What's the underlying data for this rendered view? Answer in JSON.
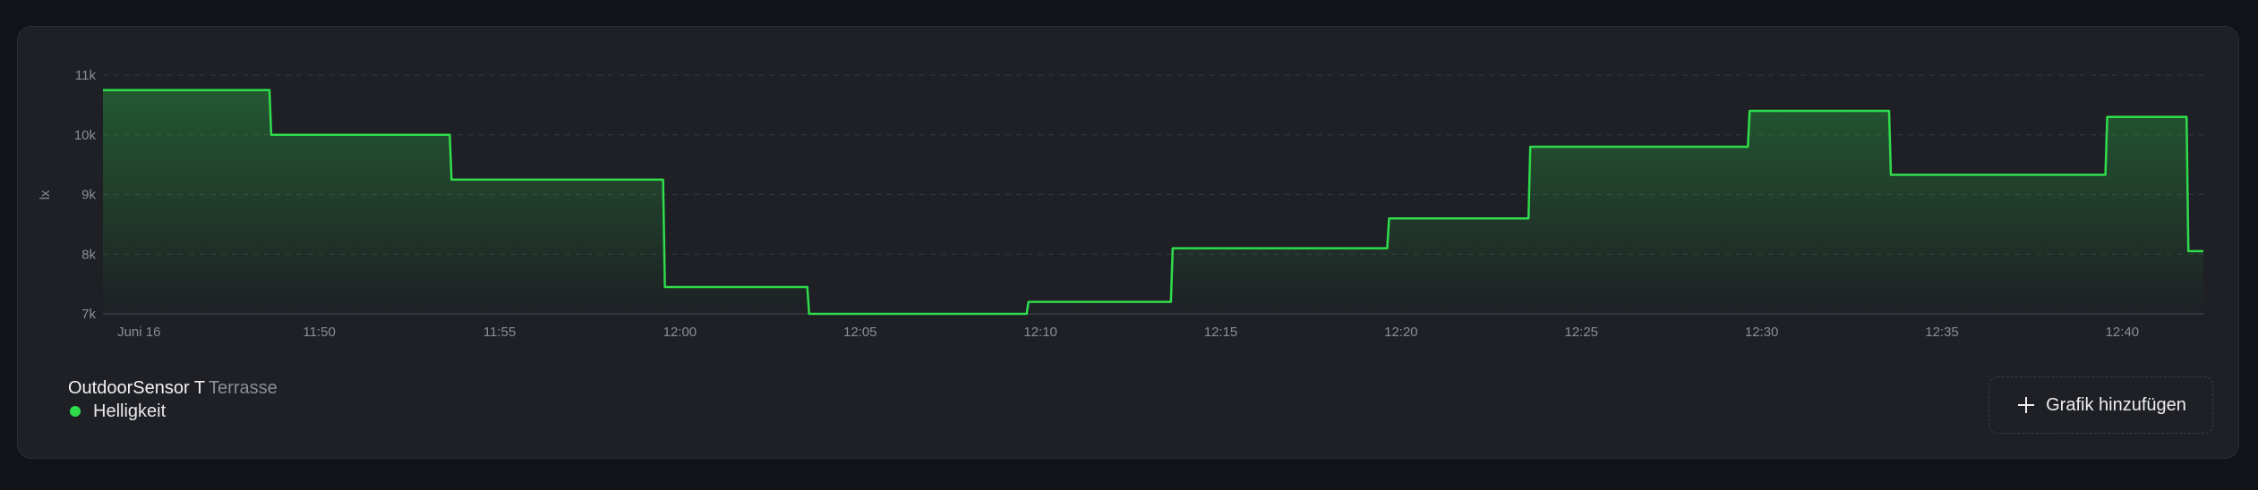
{
  "card": {
    "legend": {
      "device": "OutdoorSensor T",
      "room": "Terrasse",
      "series_name": "Helligkeit"
    },
    "add_button_label": "Grafik hinzufügen",
    "add_button_icon": "plus-icon"
  },
  "colors": {
    "background": "#111318",
    "card": "#1e2025",
    "series": "#2fdc4b",
    "axis_text": "#8b8e95"
  },
  "chart_data": {
    "type": "area",
    "step": true,
    "ylabel": "lx",
    "xlabel": "",
    "ylim": [
      7000,
      11000
    ],
    "yticks": [
      {
        "value": 7000,
        "label": "7k"
      },
      {
        "value": 8000,
        "label": "8k"
      },
      {
        "value": 9000,
        "label": "9k"
      },
      {
        "value": 10000,
        "label": "10k"
      },
      {
        "value": 11000,
        "label": "11k"
      }
    ],
    "xlim": [
      "11:44:00",
      "12:42:15"
    ],
    "xticks": [
      {
        "value": "11:45",
        "label": "Juni 16"
      },
      {
        "value": "11:50",
        "label": "11:50"
      },
      {
        "value": "11:55",
        "label": "11:55"
      },
      {
        "value": "12:00",
        "label": "12:00"
      },
      {
        "value": "12:05",
        "label": "12:05"
      },
      {
        "value": "12:10",
        "label": "12:10"
      },
      {
        "value": "12:15",
        "label": "12:15"
      },
      {
        "value": "12:20",
        "label": "12:20"
      },
      {
        "value": "12:25",
        "label": "12:25"
      },
      {
        "value": "12:30",
        "label": "12:30"
      },
      {
        "value": "12:35",
        "label": "12:35"
      },
      {
        "value": "12:40",
        "label": "12:40"
      }
    ],
    "grid": true,
    "series": [
      {
        "name": "Helligkeit",
        "color": "#2fdc4b",
        "points": [
          {
            "x": "11:44:00",
            "y": 10750
          },
          {
            "x": "11:48:40",
            "y": 10000
          },
          {
            "x": "11:53:40",
            "y": 9250
          },
          {
            "x": "11:59:35",
            "y": 7450
          },
          {
            "x": "12:03:35",
            "y": 7000
          },
          {
            "x": "12:09:40",
            "y": 7200
          },
          {
            "x": "12:13:40",
            "y": 8100
          },
          {
            "x": "12:19:40",
            "y": 8600
          },
          {
            "x": "12:23:35",
            "y": 9800
          },
          {
            "x": "12:29:40",
            "y": 10400
          },
          {
            "x": "12:33:35",
            "y": 9330
          },
          {
            "x": "12:39:35",
            "y": 10300
          },
          {
            "x": "12:41:50",
            "y": 8050
          },
          {
            "x": "12:42:15",
            "y": 8050
          }
        ]
      }
    ]
  }
}
